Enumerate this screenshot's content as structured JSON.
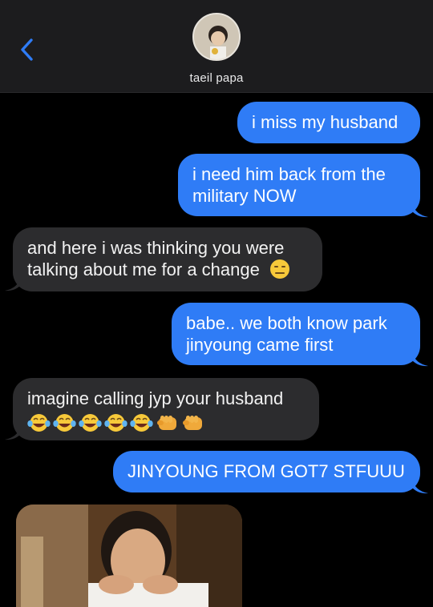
{
  "header": {
    "contact_name": "taeil papa",
    "back_icon": "chevron-left-icon",
    "accent": "#2f7cf6"
  },
  "messages": [
    {
      "id": "m1",
      "direction": "sent",
      "text": "i miss my husband"
    },
    {
      "id": "m2",
      "direction": "sent",
      "lines": [
        "i need him back from the",
        "military NOW"
      ]
    },
    {
      "id": "m3",
      "direction": "received",
      "lines": [
        "and here i was thinking you were",
        "talking about me for a change"
      ],
      "emoji": "expressionless-face"
    },
    {
      "id": "m4",
      "direction": "sent",
      "lines": [
        "babe.. we both know park",
        "jinyoung came first"
      ]
    },
    {
      "id": "m5",
      "direction": "received",
      "text": "imagine calling jyp your husband",
      "emoji": [
        "tears-of-joy",
        "tears-of-joy",
        "tears-of-joy",
        "tears-of-joy",
        "tears-of-joy",
        "oncoming-fist",
        "oncoming-fist"
      ]
    },
    {
      "id": "m6",
      "direction": "sent",
      "text": "JINYOUNG FROM GOT7 STFUUU"
    },
    {
      "id": "m7",
      "direction": "received",
      "type": "image",
      "image": "photo of a man resting his chin on his hands"
    }
  ],
  "colors": {
    "sent_bubble": "#2f7cf6",
    "received_bubble": "#2c2c2e",
    "background": "#000000",
    "header_bg": "#1c1c1e"
  }
}
